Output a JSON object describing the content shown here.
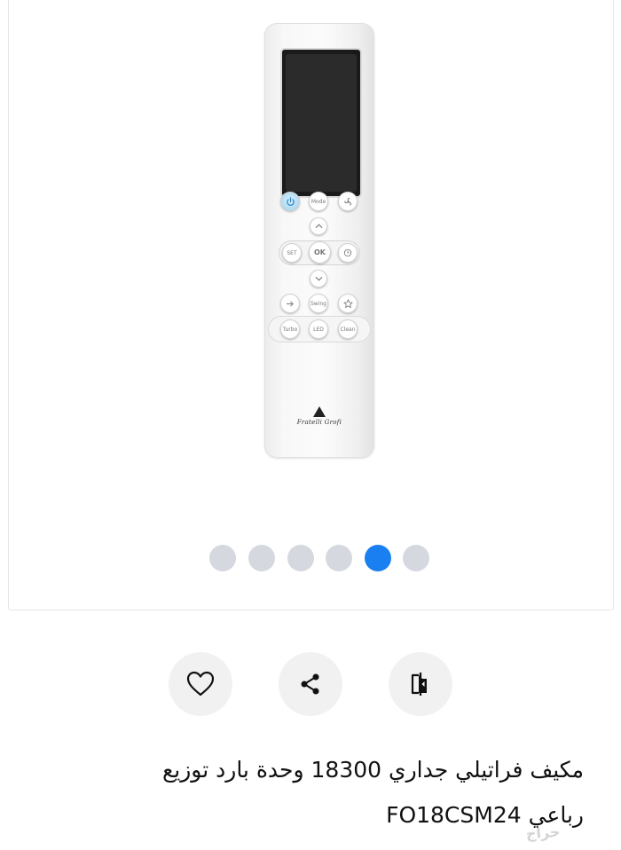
{
  "gallery": {
    "remote_logo_text": "Fratelli Grofi",
    "remote_buttons": {
      "mode": "Mode",
      "set": "SET",
      "ok": "OK",
      "swing": "Swing",
      "turbo": "Turbo",
      "led": "LED",
      "clean": "Clean"
    },
    "pagination": {
      "total": 6,
      "active_index": 4
    },
    "active_dot_color": "#1a7ff0",
    "inactive_dot_color": "#d5d8de"
  },
  "actions": {
    "favorite_icon": "heart-icon",
    "share_icon": "share-icon",
    "compare_icon": "compare-icon"
  },
  "listing": {
    "title_line1": "مكيف فراتيلي جداري 18300 وحدة بارد توزيع",
    "title_line2": "رباعي FO18CSM24"
  },
  "watermark": "حراج"
}
